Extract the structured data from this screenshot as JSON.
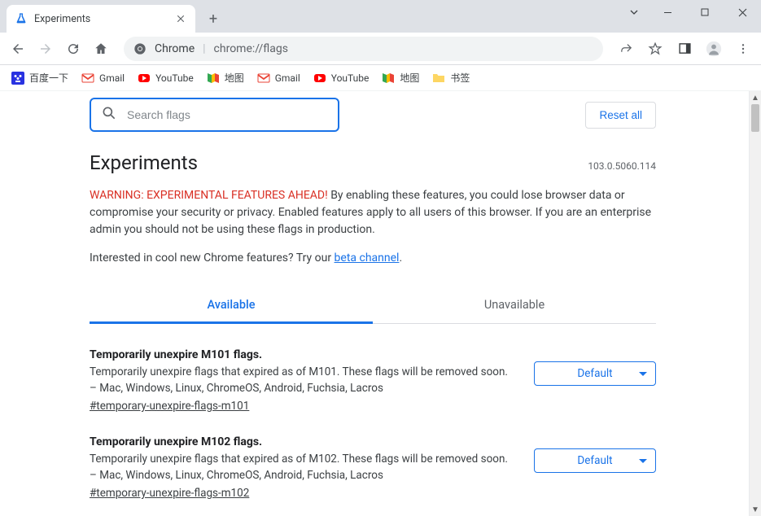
{
  "window": {
    "tab_title": "Experiments"
  },
  "toolbar": {
    "omnibox_prefix": "Chrome",
    "omnibox_url": "chrome://flags"
  },
  "bookmarks": [
    {
      "label": "百度一下",
      "color": "#2932e1"
    },
    {
      "label": "Gmail",
      "icon": "gmail"
    },
    {
      "label": "YouTube",
      "icon": "youtube"
    },
    {
      "label": "地图",
      "icon": "maps"
    },
    {
      "label": "Gmail",
      "icon": "gmail"
    },
    {
      "label": "YouTube",
      "icon": "youtube"
    },
    {
      "label": "地图",
      "icon": "maps"
    },
    {
      "label": "书签",
      "icon": "folder"
    }
  ],
  "page": {
    "search_placeholder": "Search flags",
    "reset_label": "Reset all",
    "title": "Experiments",
    "version": "103.0.5060.114",
    "warning_red": "WARNING: EXPERIMENTAL FEATURES AHEAD!",
    "warning_text": " By enabling these features, you could lose browser data or compromise your security or privacy. Enabled features apply to all users of this browser. If you are an enterprise admin you should not be using these flags in production.",
    "beta_prefix": "Interested in cool new Chrome features? Try our ",
    "beta_link": "beta channel",
    "beta_suffix": ".",
    "tabs": {
      "available": "Available",
      "unavailable": "Unavailable"
    },
    "flags": [
      {
        "title": "Temporarily unexpire M101 flags.",
        "desc": "Temporarily unexpire flags that expired as of M101. These flags will be removed soon. – Mac, Windows, Linux, ChromeOS, Android, Fuchsia, Lacros",
        "anchor": "#temporary-unexpire-flags-m101",
        "value": "Default"
      },
      {
        "title": "Temporarily unexpire M102 flags.",
        "desc": "Temporarily unexpire flags that expired as of M102. These flags will be removed soon. – Mac, Windows, Linux, ChromeOS, Android, Fuchsia, Lacros",
        "anchor": "#temporary-unexpire-flags-m102",
        "value": "Default"
      }
    ]
  }
}
